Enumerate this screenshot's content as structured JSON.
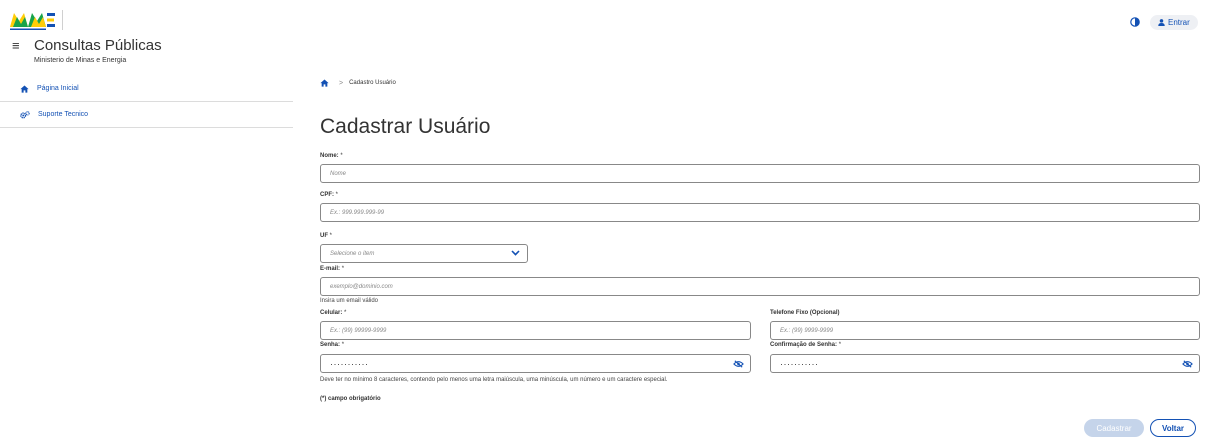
{
  "header": {
    "app_title": "Consultas Públicas",
    "ministry": "Ministerio de Minas e Energia",
    "login_label": "Entrar"
  },
  "sidebar": {
    "items": [
      {
        "label": "Página Inicial",
        "icon": "home-icon"
      },
      {
        "label": "Suporte Tecnico",
        "icon": "gears-icon"
      }
    ]
  },
  "breadcrumb": {
    "current": "Cadastro Usuário"
  },
  "page_title": "Cadastrar Usuário",
  "form": {
    "nome": {
      "label": "Nome:",
      "req": "*",
      "placeholder": "Nome"
    },
    "cpf": {
      "label": "CPF:",
      "req": "*",
      "placeholder": "Ex.: 999.999.999-99"
    },
    "uf": {
      "label": "UF",
      "req": "*",
      "placeholder": "Selecione o item"
    },
    "email": {
      "label": "E-mail:",
      "req": "*",
      "placeholder": "exemplo@dominio.com",
      "help": "Insira um email válido"
    },
    "celular": {
      "label": "Celular:",
      "req": "*",
      "placeholder": "Ex.: (99) 99999-9999"
    },
    "telefone": {
      "label": "Telefone Fixo (Opcional)",
      "placeholder": "Ex.: (99) 9999-9999"
    },
    "senha": {
      "label": "Senha:",
      "req": "*",
      "value": "···········",
      "help": "Deve ter no mínimo 8 caracteres, contendo pelo menos uma letra maiúscula, uma minúscula, um número e um caractere especial."
    },
    "confirmacao": {
      "label": "Confirmação de Senha:",
      "req": "*",
      "value": "···········"
    },
    "required_note": "(*) campo obrigatório"
  },
  "buttons": {
    "cadastrar": "Cadastrar",
    "voltar": "Voltar"
  },
  "colors": {
    "primary": "#1351b4",
    "logo_green": "#17a34a",
    "logo_yellow": "#ffcd07",
    "logo_blue": "#1351b4"
  }
}
